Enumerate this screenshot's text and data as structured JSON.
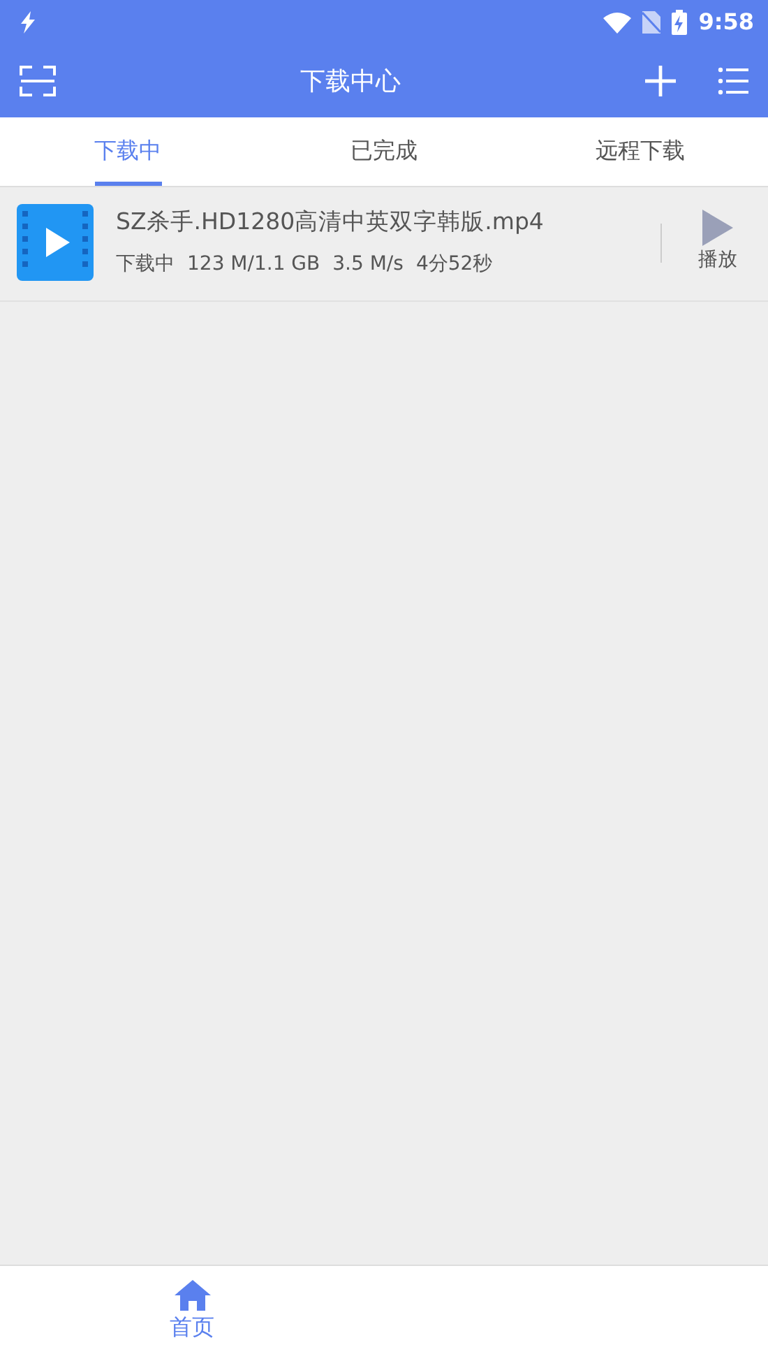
{
  "status_bar": {
    "time": "9:58"
  },
  "app_bar": {
    "title": "下载中心"
  },
  "tabs": [
    {
      "label": "下载中",
      "selected": true
    },
    {
      "label": "已完成",
      "selected": false
    },
    {
      "label": "远程下载",
      "selected": false
    }
  ],
  "downloads": [
    {
      "name": "SZ杀手.HD1280高清中英双字韩版.mp4",
      "status": "下载中",
      "size": "123 M/1.1 GB",
      "speed": "3.5 M/s",
      "remaining": "4分52秒",
      "action": "播放"
    }
  ],
  "bottom_nav": [
    {
      "label": "首页",
      "selected": true
    }
  ]
}
